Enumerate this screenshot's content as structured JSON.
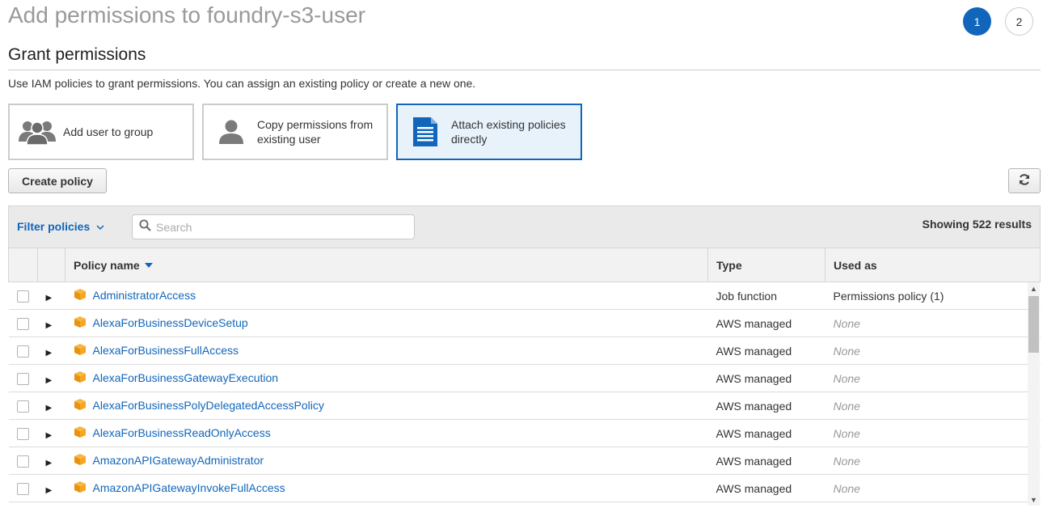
{
  "header": {
    "title": "Add permissions to foundry-s3-user",
    "steps": [
      "1",
      "2"
    ]
  },
  "grant": {
    "title": "Grant permissions",
    "description": "Use IAM policies to grant permissions. You can assign an existing policy or create a new one.",
    "options": [
      {
        "label": "Add user to group",
        "icon": "group-icon"
      },
      {
        "label": "Copy permissions from existing user",
        "icon": "user-icon"
      },
      {
        "label": "Attach existing policies directly",
        "icon": "document-icon",
        "selected": true
      }
    ]
  },
  "toolbar": {
    "create_policy_label": "Create policy",
    "refresh_icon": "refresh-icon"
  },
  "filter": {
    "filter_label": "Filter policies",
    "search_placeholder": "Search",
    "results_label": "Showing 522 results"
  },
  "table": {
    "columns": [
      "Policy name",
      "Type",
      "Used as"
    ],
    "sort_column": "Policy name",
    "rows": [
      {
        "name": "AdministratorAccess",
        "type": "Job function",
        "used_as": "Permissions policy (1)"
      },
      {
        "name": "AlexaForBusinessDeviceSetup",
        "type": "AWS managed",
        "used_as": "None"
      },
      {
        "name": "AlexaForBusinessFullAccess",
        "type": "AWS managed",
        "used_as": "None"
      },
      {
        "name": "AlexaForBusinessGatewayExecution",
        "type": "AWS managed",
        "used_as": "None"
      },
      {
        "name": "AlexaForBusinessPolyDelegatedAccessPolicy",
        "type": "AWS managed",
        "used_as": "None"
      },
      {
        "name": "AlexaForBusinessReadOnlyAccess",
        "type": "AWS managed",
        "used_as": "None"
      },
      {
        "name": "AmazonAPIGatewayAdministrator",
        "type": "AWS managed",
        "used_as": "None"
      },
      {
        "name": "AmazonAPIGatewayInvokeFullAccess",
        "type": "AWS managed",
        "used_as": "None"
      }
    ]
  },
  "colors": {
    "accent": "#1166bb",
    "policy_icon": "#f0a020"
  }
}
